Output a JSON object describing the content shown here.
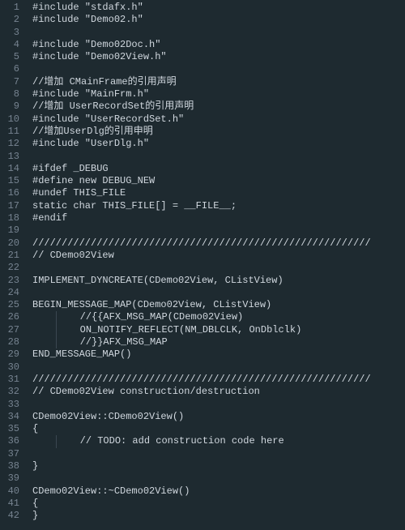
{
  "code_lines": [
    {
      "n": 1,
      "indent": 0,
      "text": "#include \"stdafx.h\""
    },
    {
      "n": 2,
      "indent": 0,
      "text": "#include \"Demo02.h\""
    },
    {
      "n": 3,
      "indent": 0,
      "text": ""
    },
    {
      "n": 4,
      "indent": 0,
      "text": "#include \"Demo02Doc.h\""
    },
    {
      "n": 5,
      "indent": 0,
      "text": "#include \"Demo02View.h\""
    },
    {
      "n": 6,
      "indent": 0,
      "text": ""
    },
    {
      "n": 7,
      "indent": 0,
      "text": "//增加 CMainFrame的引用声明"
    },
    {
      "n": 8,
      "indent": 0,
      "text": "#include \"MainFrm.h\""
    },
    {
      "n": 9,
      "indent": 0,
      "text": "//增加 UserRecordSet的引用声明"
    },
    {
      "n": 10,
      "indent": 0,
      "text": "#include \"UserRecordSet.h\""
    },
    {
      "n": 11,
      "indent": 0,
      "text": "//增加UserDlg的引用申明"
    },
    {
      "n": 12,
      "indent": 0,
      "text": "#include \"UserDlg.h\""
    },
    {
      "n": 13,
      "indent": 0,
      "text": ""
    },
    {
      "n": 14,
      "indent": 0,
      "text": "#ifdef _DEBUG"
    },
    {
      "n": 15,
      "indent": 0,
      "text": "#define new DEBUG_NEW"
    },
    {
      "n": 16,
      "indent": 0,
      "text": "#undef THIS_FILE"
    },
    {
      "n": 17,
      "indent": 0,
      "text": "static char THIS_FILE[] = __FILE__;"
    },
    {
      "n": 18,
      "indent": 0,
      "text": "#endif"
    },
    {
      "n": 19,
      "indent": 0,
      "text": ""
    },
    {
      "n": 20,
      "indent": 0,
      "text": "//////////////////////////////////////////////////////////"
    },
    {
      "n": 21,
      "indent": 0,
      "text": "// CDemo02View"
    },
    {
      "n": 22,
      "indent": 0,
      "text": ""
    },
    {
      "n": 23,
      "indent": 0,
      "text": "IMPLEMENT_DYNCREATE(CDemo02View, CListView)"
    },
    {
      "n": 24,
      "indent": 0,
      "text": ""
    },
    {
      "n": 25,
      "indent": 0,
      "text": "BEGIN_MESSAGE_MAP(CDemo02View, CListView)"
    },
    {
      "n": 26,
      "indent": 1,
      "text": "//{{AFX_MSG_MAP(CDemo02View)"
    },
    {
      "n": 27,
      "indent": 1,
      "text": "ON_NOTIFY_REFLECT(NM_DBLCLK, OnDblclk)"
    },
    {
      "n": 28,
      "indent": 1,
      "text": "//}}AFX_MSG_MAP"
    },
    {
      "n": 29,
      "indent": 0,
      "text": "END_MESSAGE_MAP()"
    },
    {
      "n": 30,
      "indent": 0,
      "text": ""
    },
    {
      "n": 31,
      "indent": 0,
      "text": "//////////////////////////////////////////////////////////"
    },
    {
      "n": 32,
      "indent": 0,
      "text": "// CDemo02View construction/destruction"
    },
    {
      "n": 33,
      "indent": 0,
      "text": ""
    },
    {
      "n": 34,
      "indent": 0,
      "text": "CDemo02View::CDemo02View()"
    },
    {
      "n": 35,
      "indent": 0,
      "text": "{"
    },
    {
      "n": 36,
      "indent": 1,
      "text": "// TODO: add construction code here"
    },
    {
      "n": 37,
      "indent": 0,
      "text": ""
    },
    {
      "n": 38,
      "indent": 0,
      "text": "}"
    },
    {
      "n": 39,
      "indent": 0,
      "text": ""
    },
    {
      "n": 40,
      "indent": 0,
      "text": "CDemo02View::~CDemo02View()"
    },
    {
      "n": 41,
      "indent": 0,
      "text": "{"
    },
    {
      "n": 42,
      "indent": 0,
      "text": "}"
    }
  ]
}
